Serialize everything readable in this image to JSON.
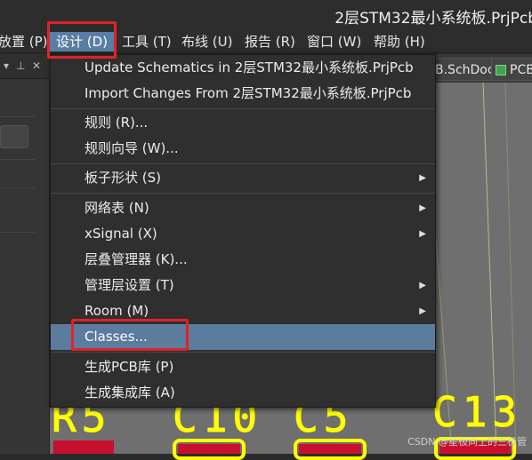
{
  "window": {
    "title": "2层STM32最小系统板.PrjPcb"
  },
  "menubar": {
    "items": [
      {
        "label": "放置 (P)"
      },
      {
        "label": "设计 (D)"
      },
      {
        "label": "工具 (T)"
      },
      {
        "label": "布线 (U)"
      },
      {
        "label": "报告 (R)"
      },
      {
        "label": "窗口 (W)"
      },
      {
        "label": "帮助 (H)"
      }
    ]
  },
  "tabs": [
    {
      "label": "B.SchDoc"
    },
    {
      "label": "PCB"
    }
  ],
  "design_menu": {
    "items": [
      {
        "label": "Update Schematics in 2层STM32最小系统板.PrjPcb"
      },
      {
        "label": "Import Changes From 2层STM32最小系统板.PrjPcb"
      },
      {
        "label": "规则 (R)..."
      },
      {
        "label": "规则向导 (W)..."
      },
      {
        "label": "板子形状 (S)"
      },
      {
        "label": "网络表 (N)"
      },
      {
        "label": "xSignal (X)"
      },
      {
        "label": "层叠管理器 (K)..."
      },
      {
        "label": "管理层设置 (T)"
      },
      {
        "label": "Room (M)"
      },
      {
        "label": "Classes..."
      },
      {
        "label": "生成PCB库 (P)"
      },
      {
        "label": "生成集成库 (A)"
      }
    ]
  },
  "pcb": {
    "designators": [
      "R5",
      "C10",
      "C5",
      "C13"
    ]
  },
  "watermark": "CSDN @星极同上的三极管",
  "colors": {
    "highlight_box": "#e0222b",
    "menu_selected": "#5c7c9e",
    "silkscreen": "#ffff00",
    "pad": "#c8102e"
  }
}
